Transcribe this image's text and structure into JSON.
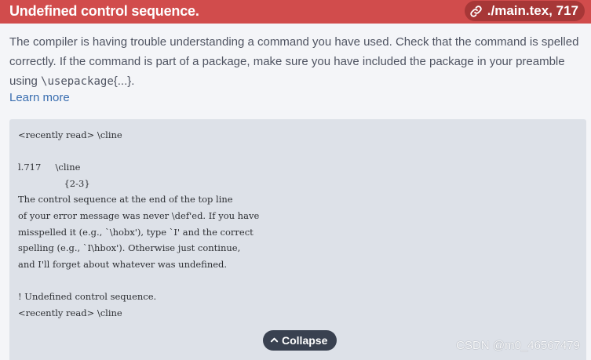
{
  "header": {
    "title": "Undefined control sequence.",
    "location": "./main.tex, 717",
    "icon": "link-icon",
    "background": "#d14c4c"
  },
  "description": {
    "text_before": "The compiler is having trouble understanding a command you have used. Check that the command is spelled correctly. If the command is part of a package, make sure you have included the package in your preamble using ",
    "code": "\\usepackage",
    "text_after": "{...}.",
    "learn_more": "Learn more"
  },
  "log": {
    "lines": [
      "<recently read> \\cline",
      "",
      "l.717     \\cline",
      "                {2-3}",
      "The control sequence at the end of the top line",
      "of your error message was never \\def'ed. If you have",
      "misspelled it (e.g., `\\hobx'), type `I' and the correct",
      "spelling (e.g., `I\\hbox'). Otherwise just continue,",
      "and I'll forget about whatever was undefined.",
      "",
      "! Undefined control sequence.",
      "<recently read> \\cline"
    ]
  },
  "collapse": {
    "label": "Collapse",
    "icon": "chevron-up-icon"
  },
  "watermark": "CSDN @m0_46567479"
}
